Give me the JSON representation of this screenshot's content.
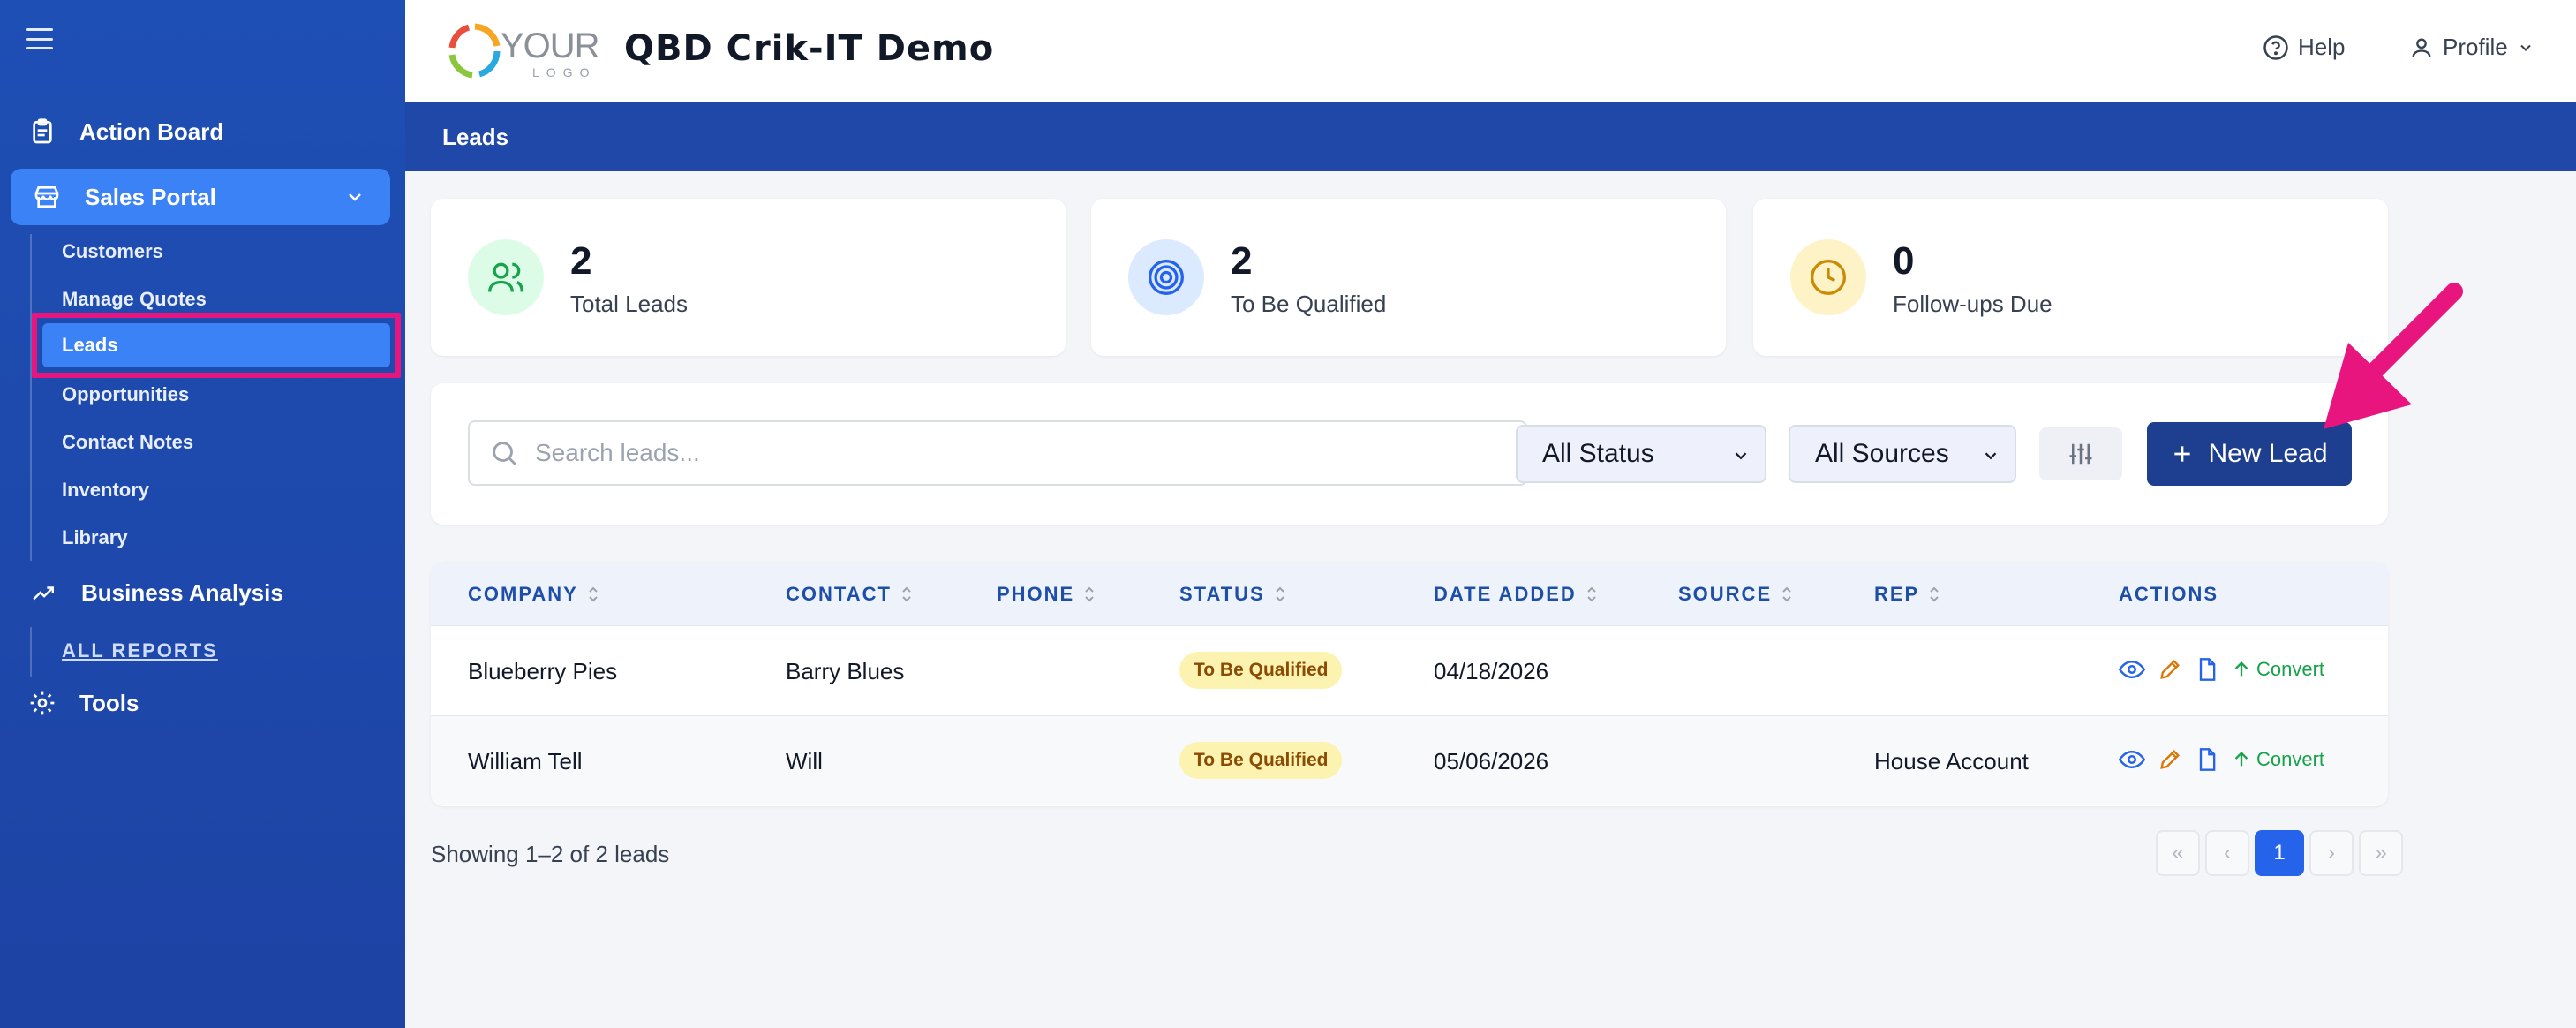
{
  "sidebar": {
    "action_board": "Action Board",
    "sales_portal": "Sales Portal",
    "sub_items": [
      "Customers",
      "Manage Quotes",
      "Leads",
      "Opportunities",
      "Contact Notes",
      "Inventory",
      "Library"
    ],
    "business_analysis": "Business Analysis",
    "all_reports": "ALL REPORTS",
    "tools": "Tools"
  },
  "header": {
    "logo_main": "YOUR",
    "logo_sub": "LOGO",
    "title": "QBD Crik-IT Demo",
    "help": "Help",
    "profile": "Profile"
  },
  "breadcrumb": "Leads",
  "stats": [
    {
      "value": "2",
      "label": "Total Leads",
      "icon": "users-icon"
    },
    {
      "value": "2",
      "label": "To Be Qualified",
      "icon": "target-icon"
    },
    {
      "value": "0",
      "label": "Follow-ups Due",
      "icon": "clock-icon"
    }
  ],
  "filters": {
    "search_placeholder": "Search leads...",
    "status": "All Status",
    "source": "All Sources",
    "new_lead": "New Lead"
  },
  "table": {
    "columns": [
      "COMPANY",
      "CONTACT",
      "PHONE",
      "STATUS",
      "DATE ADDED",
      "SOURCE",
      "REP",
      "ACTIONS"
    ],
    "rows": [
      {
        "company": "Blueberry Pies",
        "contact": "Barry Blues",
        "phone": "",
        "status": "To Be Qualified",
        "date_added": "04/18/2026",
        "source": "",
        "rep": "",
        "convert": "Convert"
      },
      {
        "company": "William Tell",
        "contact": "Will",
        "phone": "",
        "status": "To Be Qualified",
        "date_added": "05/06/2026",
        "source": "",
        "rep": "House Account",
        "convert": "Convert"
      }
    ]
  },
  "pagination": {
    "summary": "Showing 1–2 of 2 leads",
    "first": "«",
    "prev": "‹",
    "current": "1",
    "next": "›",
    "last": "»"
  },
  "colors": {
    "sidebar": "#1e4fb4",
    "active": "#3b82f6",
    "highlight": "#e8157e",
    "primary_button": "#1e3f8f",
    "badge": "#fdf3b0"
  }
}
